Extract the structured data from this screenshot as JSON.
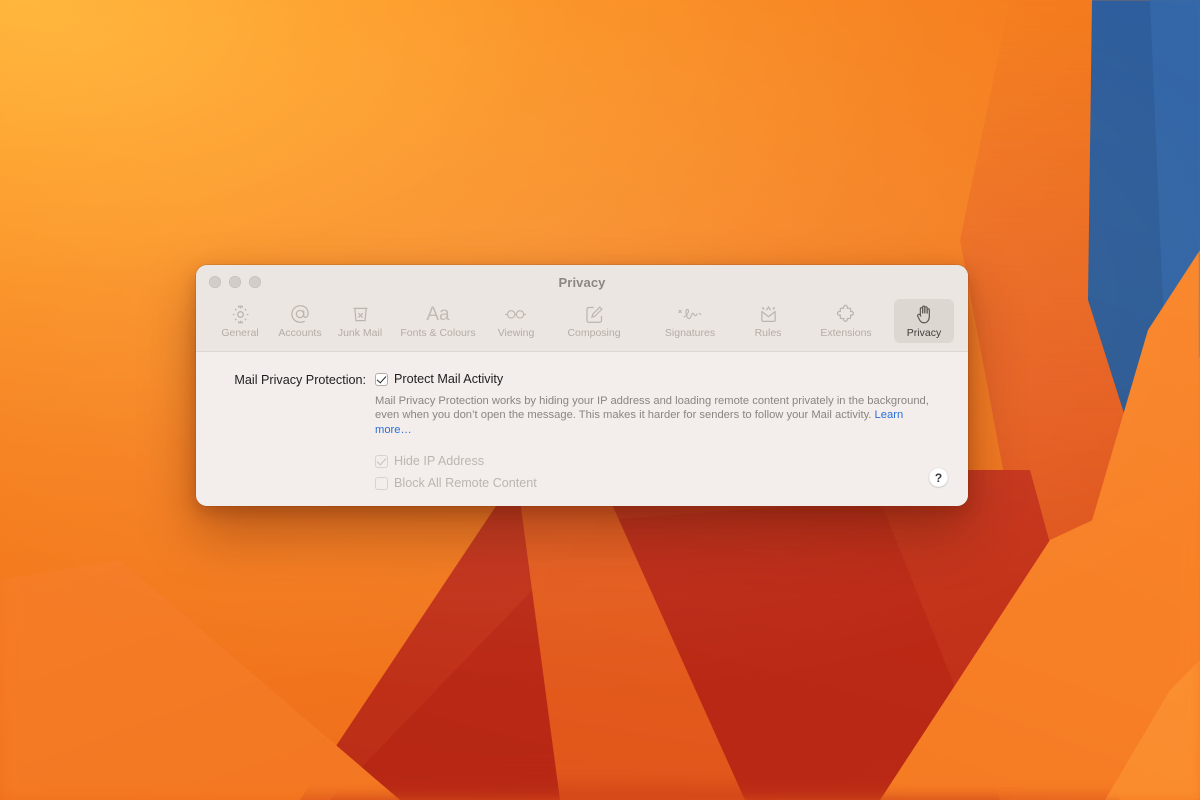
{
  "window": {
    "title": "Privacy",
    "traffic_lights": [
      "close",
      "minimize",
      "zoom"
    ]
  },
  "toolbar": {
    "items": [
      {
        "label": "General",
        "icon": "gear-icon"
      },
      {
        "label": "Accounts",
        "icon": "at-sign-icon"
      },
      {
        "label": "Junk Mail",
        "icon": "trash-x-icon"
      },
      {
        "label": "Fonts & Colours",
        "icon": "aa-text-icon"
      },
      {
        "label": "Viewing",
        "icon": "eyeglasses-icon"
      },
      {
        "label": "Composing",
        "icon": "pencil-square-icon"
      },
      {
        "label": "Signatures",
        "icon": "signature-scribble-icon"
      },
      {
        "label": "Rules",
        "icon": "envelope-arrows-icon"
      },
      {
        "label": "Extensions",
        "icon": "puzzle-piece-icon"
      },
      {
        "label": "Privacy",
        "icon": "raised-hand-icon",
        "selected": true
      }
    ]
  },
  "main": {
    "field_label": "Mail Privacy Protection:",
    "protect_checkbox": {
      "label": "Protect Mail Activity",
      "checked": true,
      "enabled": true
    },
    "description": "Mail Privacy Protection works by hiding your IP address and loading remote content privately in the background, even when you don’t open the message. This makes it harder for senders to follow your Mail activity.",
    "learn_more": "Learn more…",
    "sub_options": [
      {
        "label": "Hide IP Address",
        "checked": true,
        "enabled": false
      },
      {
        "label": "Block All Remote Content",
        "checked": false,
        "enabled": false
      }
    ],
    "help_button": "?"
  },
  "colors": {
    "window_chrome": "#ece6e2",
    "content_bg": "#f3eeeb",
    "link": "#2b6ed8",
    "label_text": "#1d1d1f",
    "secondary_text": "#8b8580",
    "disabled_text": "#bdb5af",
    "selected_tab_bg": "#ddd7d2",
    "wallpaper_orange": "#f6811f",
    "wallpaper_blue": "#2b5891",
    "wallpaper_deep_red": "#c6341a"
  }
}
